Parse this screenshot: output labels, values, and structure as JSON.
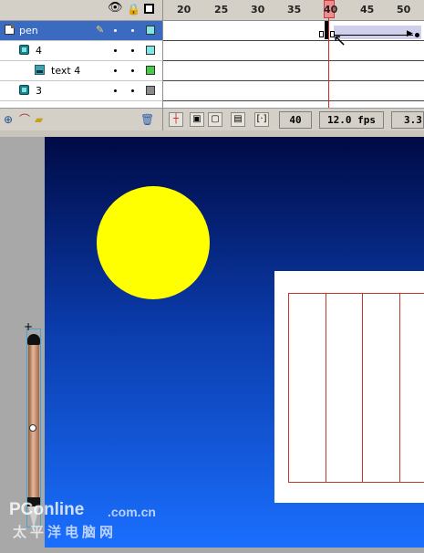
{
  "layers": {
    "items": [
      {
        "name": "pen",
        "color": "#7ee8e8",
        "selected": true,
        "icon": "layer-page-icon"
      },
      {
        "name": "4",
        "color": "#7ee8e8",
        "selected": false,
        "icon": "folder-icon"
      },
      {
        "name": "text 4",
        "color": "#44cc44",
        "selected": false,
        "icon": "text-layer-icon"
      },
      {
        "name": "3",
        "color": "#8a8a8a",
        "selected": false,
        "icon": "folder-icon"
      }
    ]
  },
  "timeline": {
    "ruler_numbers": [
      "20",
      "25",
      "30",
      "35",
      "40",
      "45",
      "50"
    ],
    "current_frame": "40",
    "frame_rate": "12.0 fps",
    "elapsed_time": "3.3"
  },
  "colors": {
    "selection": "#3a6bc0",
    "playhead": "#f08c8c",
    "moon": "#ffff00",
    "sky_top": "#000a45",
    "sky_bottom": "#1a6fff"
  },
  "watermark": {
    "brand": "PConline",
    "domain": ".com.cn",
    "chinese": "太平洋电脑网"
  }
}
